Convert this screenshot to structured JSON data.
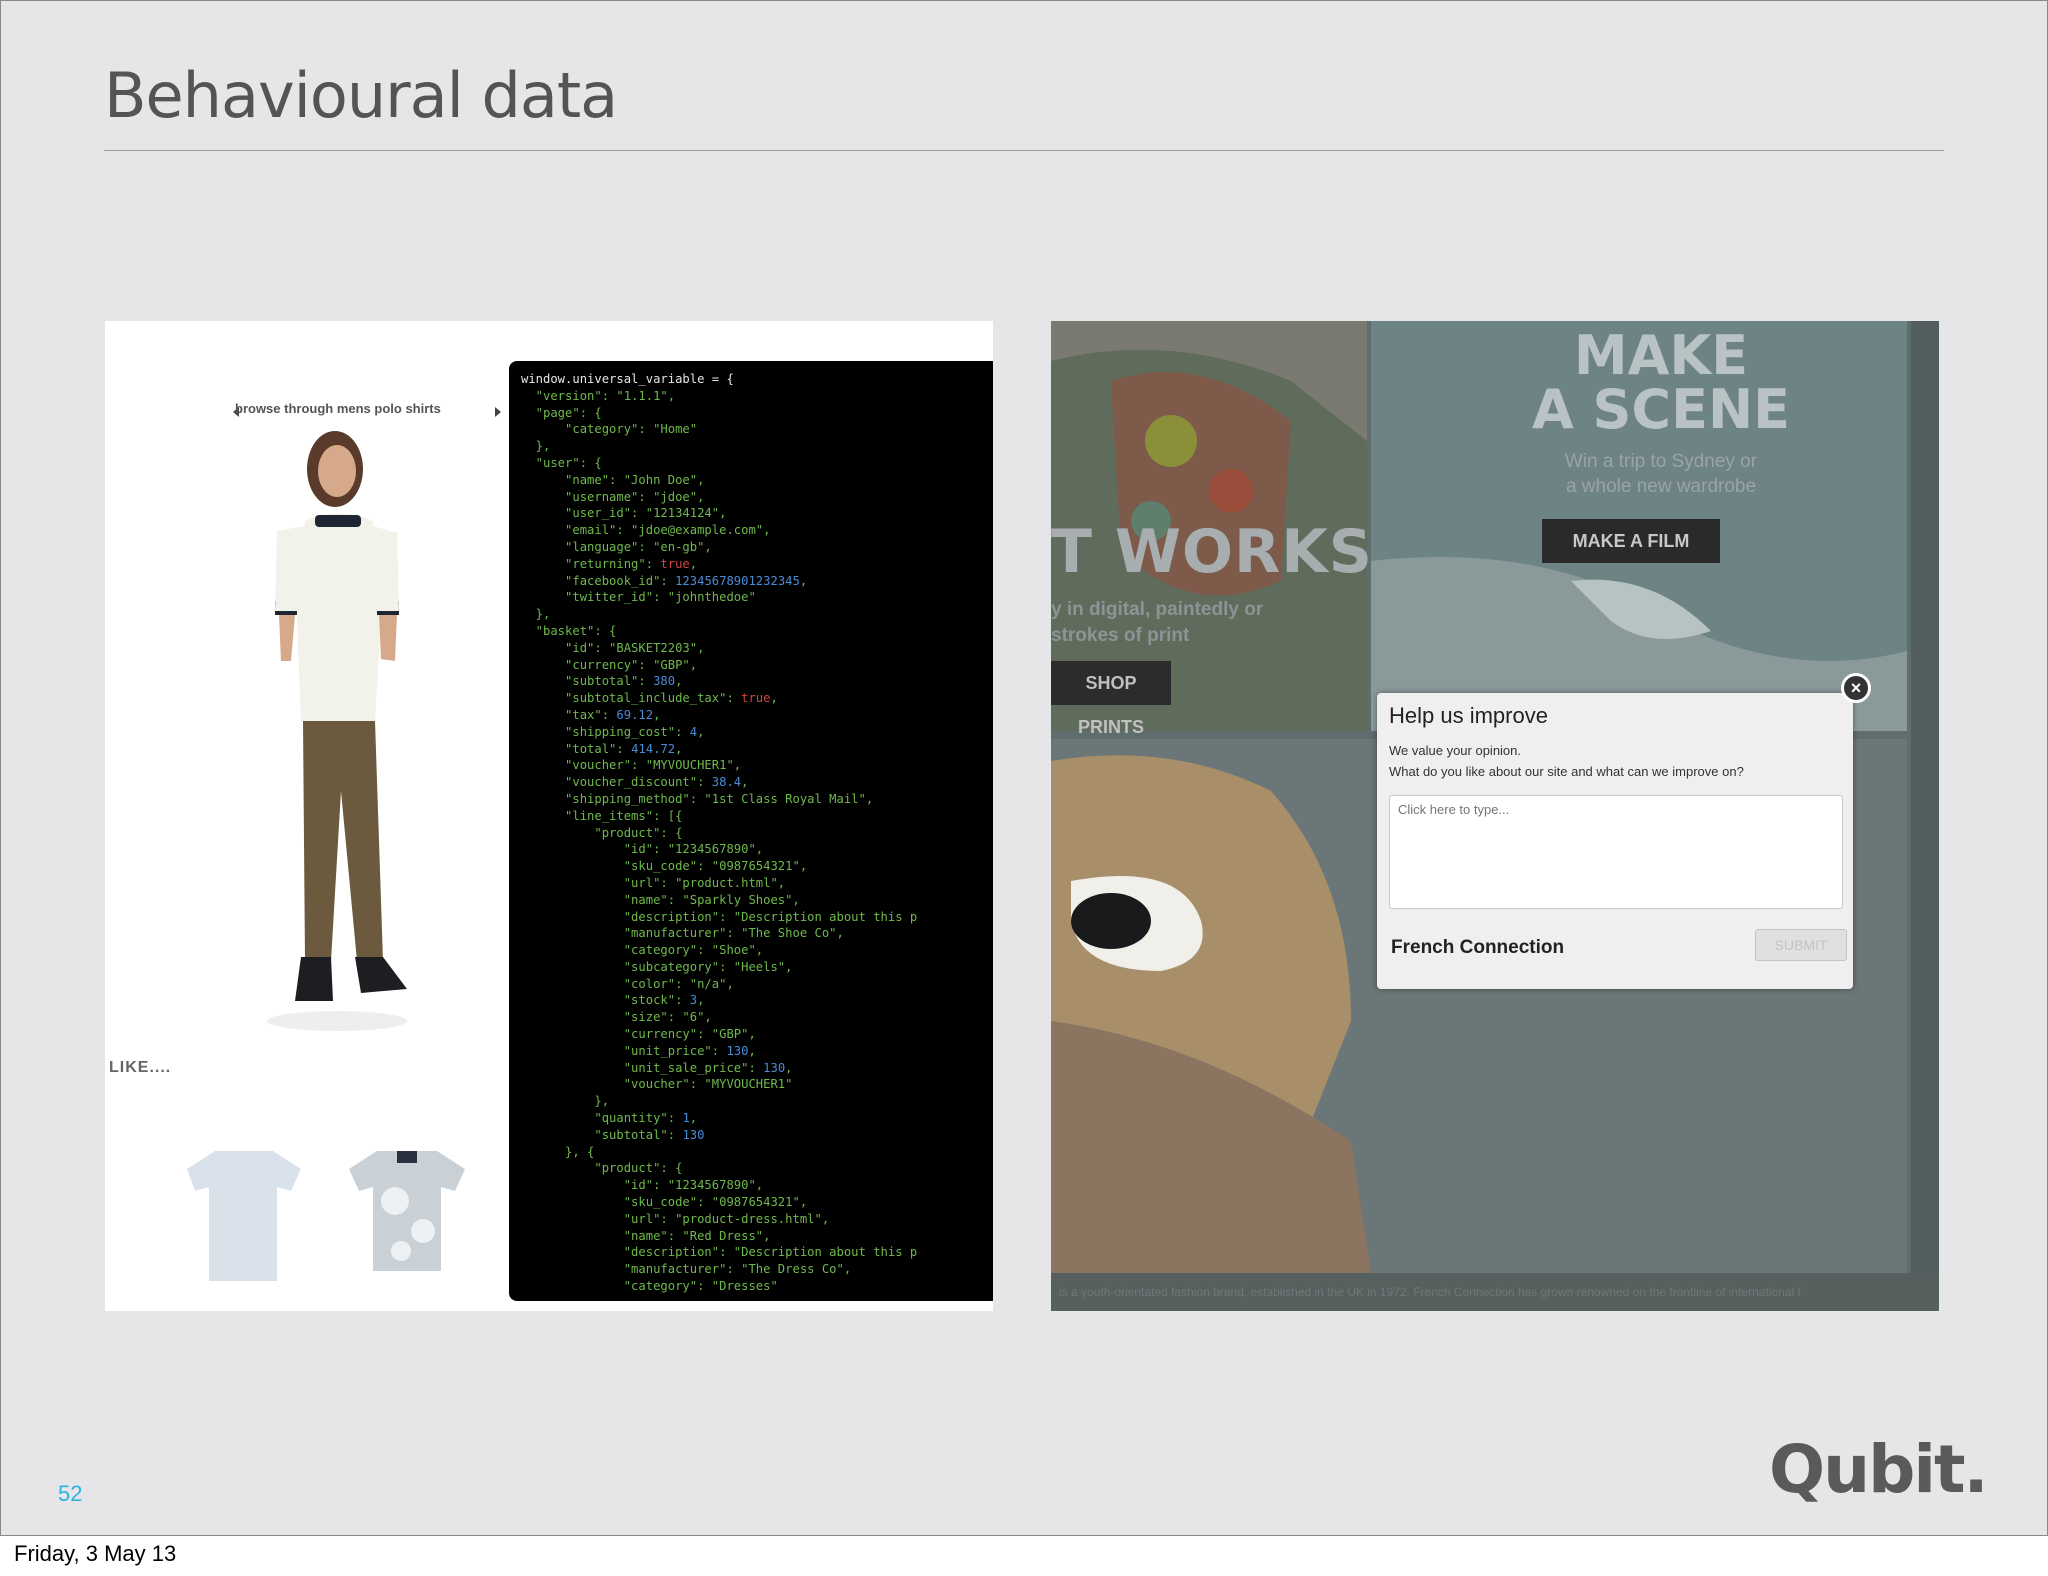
{
  "slide": {
    "title": "Behavioural data",
    "page_number": "52",
    "logo_text": "Qubit.",
    "date": "Friday, 3 May 13"
  },
  "left_panel": {
    "browse_text": "browse through  mens polo shirts",
    "like_label": "LIKE....",
    "code_lines": [
      [
        "w",
        "window.universal_variable = {"
      ],
      [
        "g",
        "  \"version\": \"1.1.1\","
      ],
      [
        "g",
        "  \"page\": {"
      ],
      [
        "g",
        "      \"category\": \"Home\""
      ],
      [
        "g",
        "  },"
      ],
      [
        "g",
        "  \"user\": {"
      ],
      [
        "g",
        "      \"name\": \"John Doe\","
      ],
      [
        "g",
        "      \"username\": \"jdoe\","
      ],
      [
        "g",
        "      \"user_id\": \"12134124\","
      ],
      [
        "g",
        "      \"email\": \"jdoe@example.com\","
      ],
      [
        "g",
        "      \"language\": \"en-gb\","
      ],
      [
        "gr",
        "      \"returning\": |true|,"
      ],
      [
        "gb",
        "      \"facebook_id\": |12345678901232345|,"
      ],
      [
        "g",
        "      \"twitter_id\": \"johnthedoe\""
      ],
      [
        "g",
        "  },"
      ],
      [
        "g",
        "  \"basket\": {"
      ],
      [
        "g",
        "      \"id\": \"BASKET2203\","
      ],
      [
        "g",
        "      \"currency\": \"GBP\","
      ],
      [
        "gb",
        "      \"subtotal\": |380|,"
      ],
      [
        "gr",
        "      \"subtotal_include_tax\": |true|,"
      ],
      [
        "gb",
        "      \"tax\": |69.12|,"
      ],
      [
        "gb",
        "      \"shipping_cost\": |4|,"
      ],
      [
        "gb",
        "      \"total\": |414.72|,"
      ],
      [
        "g",
        "      \"voucher\": \"MYVOUCHER1\","
      ],
      [
        "gb",
        "      \"voucher_discount\": |38.4|,"
      ],
      [
        "g",
        "      \"shipping_method\": \"1st Class Royal Mail\","
      ],
      [
        "g",
        "      \"line_items\": [{"
      ],
      [
        "g",
        "          \"product\": {"
      ],
      [
        "g",
        "              \"id\": \"1234567890\","
      ],
      [
        "g",
        "              \"sku_code\": \"0987654321\","
      ],
      [
        "g",
        "              \"url\": \"product.html\","
      ],
      [
        "g",
        "              \"name\": \"Sparkly Shoes\","
      ],
      [
        "g",
        "              \"description\": \"Description about this p"
      ],
      [
        "g",
        "              \"manufacturer\": \"The Shoe Co\","
      ],
      [
        "g",
        "              \"category\": \"Shoe\","
      ],
      [
        "g",
        "              \"subcategory\": \"Heels\","
      ],
      [
        "g",
        "              \"color\": \"n/a\","
      ],
      [
        "gb",
        "              \"stock\": |3|,"
      ],
      [
        "g",
        "              \"size\": \"6\","
      ],
      [
        "g",
        "              \"currency\": \"GBP\","
      ],
      [
        "gb",
        "              \"unit_price\": |130|,"
      ],
      [
        "gb",
        "              \"unit_sale_price\": |130|,"
      ],
      [
        "g",
        "              \"voucher\": \"MYVOUCHER1\""
      ],
      [
        "g",
        "          },"
      ],
      [
        "gb",
        "          \"quantity\": |1|,"
      ],
      [
        "gb",
        "          \"subtotal\": |130|"
      ],
      [
        "g",
        "      }, {"
      ],
      [
        "g",
        "          \"product\": {"
      ],
      [
        "g",
        "              \"id\": \"1234567890\","
      ],
      [
        "g",
        "              \"sku_code\": \"0987654321\","
      ],
      [
        "g",
        "              \"url\": \"product-dress.html\","
      ],
      [
        "g",
        "              \"name\": \"Red Dress\","
      ],
      [
        "g",
        "              \"description\": \"Description about this p"
      ],
      [
        "g",
        "              \"manufacturer\": \"The Dress Co\","
      ],
      [
        "g",
        "              \"category\": \"Dresses\""
      ]
    ]
  },
  "right_panel": {
    "scene_title_line1": "MAKE",
    "scene_title_line2": "A SCENE",
    "scene_sub_line1": "Win a trip to Sydney or",
    "scene_sub_line2": "a whole new wardrobe",
    "film_button": "MAKE A FILM",
    "works_title": "T WORKS",
    "works_sub_line1": "y in digital, paintedly or",
    "works_sub_line2": "strokes of print",
    "shop_button": "SHOP PRINTS",
    "footer_text": "is a youth-orientated fashion brand, established in the UK in 1972. French Connection has grown renowned on the frontline of international f",
    "popup": {
      "title": "Help us improve",
      "line1": "We value your opinion.",
      "line2": "What do you like about our site and what can we improve on?",
      "input_placeholder": "Click here to type...",
      "brand": "French Connection",
      "submit": "SUBMIT"
    }
  },
  "colors": {
    "slide_bg": "#e6e6e8",
    "page_number": "#2ab3df",
    "code_green": "#6fb84c",
    "code_blue": "#4a8bd8",
    "code_red": "#d0463b"
  }
}
